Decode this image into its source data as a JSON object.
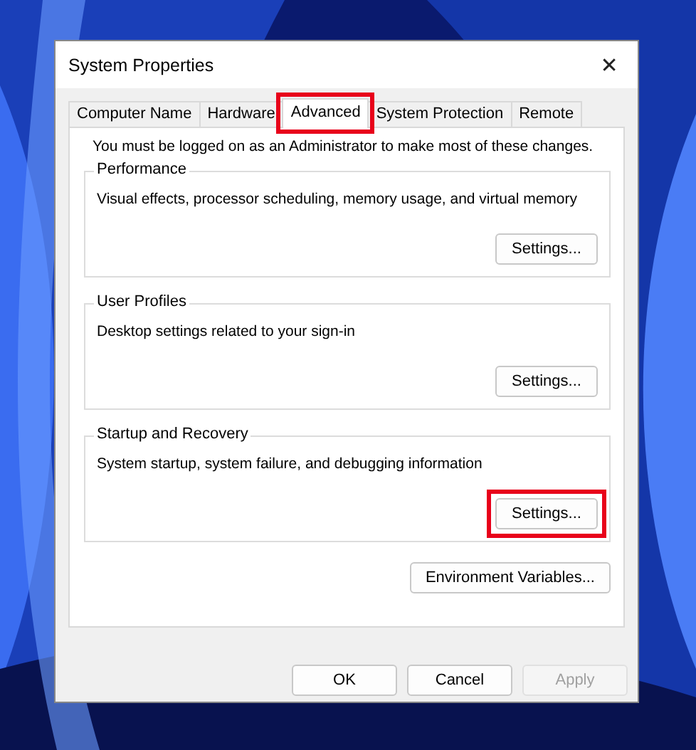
{
  "window": {
    "title": "System Properties",
    "close": "✕"
  },
  "tabs": [
    {
      "label": "Computer Name",
      "selected": false,
      "highlighted": false
    },
    {
      "label": "Hardware",
      "selected": false,
      "highlighted": false
    },
    {
      "label": "Advanced",
      "selected": true,
      "highlighted": true
    },
    {
      "label": "System Protection",
      "selected": false,
      "highlighted": false
    },
    {
      "label": "Remote",
      "selected": false,
      "highlighted": false
    }
  ],
  "notice": "You must be logged on as an Administrator to make most of these changes.",
  "groups": [
    {
      "title": "Performance",
      "description": "Visual effects, processor scheduling, memory usage, and virtual memory",
      "button": {
        "label": "Settings...",
        "highlighted": false
      }
    },
    {
      "title": "User Profiles",
      "description": "Desktop settings related to your sign-in",
      "button": {
        "label": "Settings...",
        "highlighted": false
      }
    },
    {
      "title": "Startup and Recovery",
      "description": "System startup, system failure, and debugging information",
      "button": {
        "label": "Settings...",
        "highlighted": true
      }
    }
  ],
  "environment_button": {
    "label": "Environment Variables..."
  },
  "buttons": [
    {
      "label": "OK",
      "disabled": false
    },
    {
      "label": "Cancel",
      "disabled": false
    },
    {
      "label": "Apply",
      "disabled": true
    }
  ]
}
